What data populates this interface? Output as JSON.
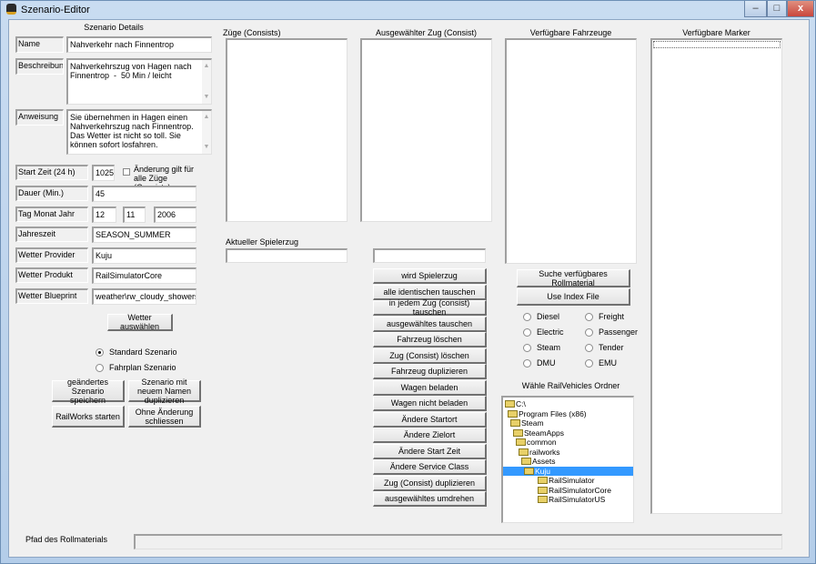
{
  "window": {
    "title": "Szenario-Editor",
    "controls": [
      "minimize",
      "maximize",
      "close"
    ]
  },
  "details": {
    "heading": "Szenario Details",
    "name_label": "Name",
    "name_value": "Nahverkehr nach Finnentrop",
    "beschreibung_label": "Beschreibung",
    "beschreibung_value": "Nahverkehrszug von Hagen nach Finnentrop  -  50 Min / leicht",
    "anweisung_label": "Anweisung",
    "anweisung_value": "Sie übernehmen in Hagen einen Nahverkehrszug nach Finnentrop. Das Wetter ist nicht so toll. Sie können sofort losfahren.",
    "startzeit_label": "Start Zeit (24 h)",
    "startzeit_value": "1025",
    "checkbox_label": "Änderung gilt für alle Züge (Consists)",
    "checkbox_checked": false,
    "dauer_label": "Dauer (Min.)",
    "dauer_value": "45",
    "datum_label": "Tag Monat Jahr",
    "tag": "12",
    "monat": "11",
    "jahr": "2006",
    "jahreszeit_label": "Jahreszeit",
    "jahreszeit_value": "SEASON_SUMMER",
    "provider_label": "Wetter Provider",
    "provider_value": "Kuju",
    "produkt_label": "Wetter Produkt",
    "produkt_value": "RailSimulatorCore",
    "blueprint_label": "Wetter Blueprint",
    "blueprint_value": "weather\\rw_cloudy_showers.xml",
    "wetter_button": "Wetter auswählen",
    "radio_standard": "Standard Szenario",
    "radio_fahrplan": "Fahrplan Szenario",
    "selected": "standard",
    "save_button": "geändertes Szenario speichern",
    "duplicate_button": "Szenario mit neuem Namen duplizieren",
    "start_button": "RailWorks starten",
    "close_button": "Ohne Änderung schliessen"
  },
  "consists": {
    "label": "Züge (Consists)",
    "items": []
  },
  "selected_consist": {
    "label": "Ausgewählter Zug (Consist)",
    "items": [],
    "input_value": ""
  },
  "player": {
    "label": "Aktueller Spielerzug",
    "value": ""
  },
  "actions": [
    "wird Spielerzug",
    "alle identischen tauschen",
    "in jedem Zug (consist) tauschen",
    "ausgewähltes tauschen",
    "Fahrzeug löschen",
    "Zug (Consist) löschen",
    "Fahrzeug duplizieren",
    "Wagen beladen",
    "Wagen nicht beladen",
    "Ändere Startort",
    "Ändere Zielort",
    "Ändere Start Zeit",
    "Ändere Service Class",
    "Zug (Consist) duplizieren",
    "ausgewähltes umdrehen"
  ],
  "vehicles": {
    "label": "Verfügbare Fahrzeuge",
    "items": [],
    "search_button": "Suche verfügbares Rollmaterial",
    "index_button": "Use Index File",
    "filters": [
      "Diesel",
      "Freight",
      "Electric",
      "Passenger",
      "Steam",
      "Tender",
      "DMU",
      "EMU"
    ],
    "folder_label": "Wähle RailVehicles Ordner",
    "tree": [
      "C:\\",
      "Program Files (x86)",
      "Steam",
      "SteamApps",
      "common",
      "railworks",
      "Assets",
      "Kuju",
      "RailSimulator",
      "RailSimulatorCore",
      "RailSimulatorUS"
    ],
    "tree_selected": "Kuju"
  },
  "markers": {
    "label": "Verfügbare Marker",
    "items": []
  },
  "footer": {
    "path_label": "Pfad des Rollmaterials",
    "path_value": ""
  },
  "colors": {
    "selection": "#3399ff",
    "face": "#f0f0f0",
    "close": "#c9463d"
  }
}
